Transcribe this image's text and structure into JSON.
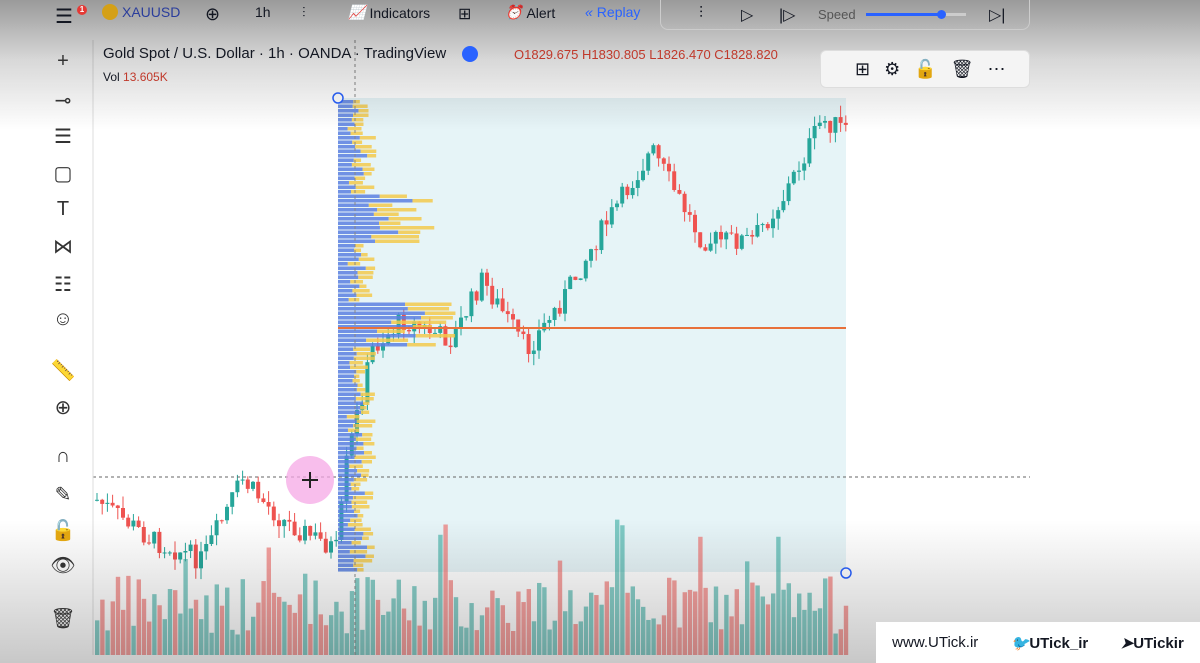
{
  "toolbar": {
    "symbol": "XAUUSD",
    "interval": "1h",
    "indicators": "Indicators",
    "alert": "Alert",
    "replay": "Replay",
    "speed": "Speed",
    "speed_level": 0.75,
    "notification_count": "1"
  },
  "legend": {
    "title": "Gold Spot / U.S. Dollar · 1h · OANDA · TradingView",
    "open": "O1829.675",
    "high": "H1830.805",
    "low": "L1826.470",
    "close": "C1828.820",
    "vol_label": "Vol",
    "vol_value": "13.605K"
  },
  "left_tools": [
    "crosshair-icon",
    "horizontal-line-icon",
    "fib-icon",
    "rectangle-icon",
    "text-icon",
    "pattern-icon",
    "prediction-icon",
    "emoji-icon",
    "ruler-icon",
    "zoom-in-icon",
    "magnet-icon",
    "lock-draw-icon",
    "unlock-icon",
    "eye-icon",
    "trash-icon"
  ],
  "colors": {
    "up": "#26a69a",
    "down": "#ef5350",
    "profile_up": "#5b7fe0",
    "profile_down": "#f2c94c",
    "poc": "#e8703a",
    "range_bg": "#e6f4f7"
  },
  "watermark": {
    "site": "www.UTick.ir",
    "twitter": "UTick_ir",
    "telegram": "UTickir"
  }
}
